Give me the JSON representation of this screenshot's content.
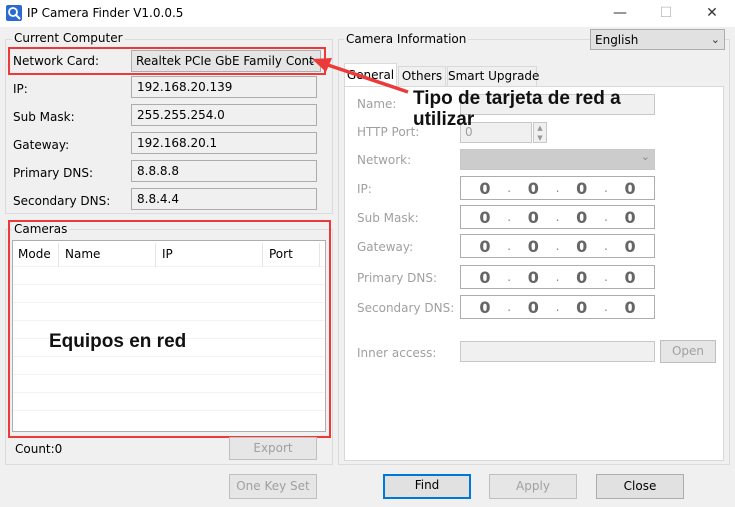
{
  "window": {
    "title": "IP Camera Finder V1.0.0.5",
    "minimize": "—",
    "maximize": "☐",
    "close": "✕"
  },
  "current": {
    "title": "Current Computer",
    "network_card_label": "Network Card:",
    "network_card_value": "Realtek PCIe GbE Family Cont",
    "ip_label": "IP:",
    "ip_value": "192.168.20.139",
    "mask_label": "Sub Mask:",
    "mask_value": "255.255.254.0",
    "gateway_label": "Gateway:",
    "gateway_value": "192.168.20.1",
    "pdns_label": "Primary DNS:",
    "pdns_value": "8.8.8.8",
    "sdns_label": "Secondary DNS:",
    "sdns_value": "8.8.4.4"
  },
  "cameras": {
    "title": "Cameras",
    "columns": [
      "Mode",
      "Name",
      "IP",
      "Port"
    ],
    "count": "Count:0",
    "export": "Export",
    "one_key_set": "One Key Set"
  },
  "info": {
    "title": "Camera Information",
    "language": "English",
    "tabs": [
      "General",
      "Others",
      "Smart Upgrade"
    ],
    "name_label": "Name:",
    "http_label": "HTTP Port:",
    "http_value": "0",
    "network_label": "Network:",
    "ip_label": "IP:",
    "mask_label": "Sub Mask:",
    "gateway_label": "Gateway:",
    "pdns_label": "Primary DNS:",
    "sdns_label": "Secondary DNS:",
    "octets": [
      "0",
      "0",
      "0",
      "0"
    ],
    "inner_label": "Inner access:",
    "open": "Open"
  },
  "buttons": {
    "find": "Find",
    "apply": "Apply",
    "close": "Close"
  },
  "annotations": {
    "network_card_line1": "Tipo de tarjeta de red a",
    "network_card_line2": "utilizar",
    "cameras_note": "Equipos en red"
  },
  "colors": {
    "annotation_red": "#ec3a3a",
    "focus_blue": "#0078d7"
  },
  "icons": {
    "app": "camera-search-icon",
    "dropdown": "chevron-down-icon"
  }
}
